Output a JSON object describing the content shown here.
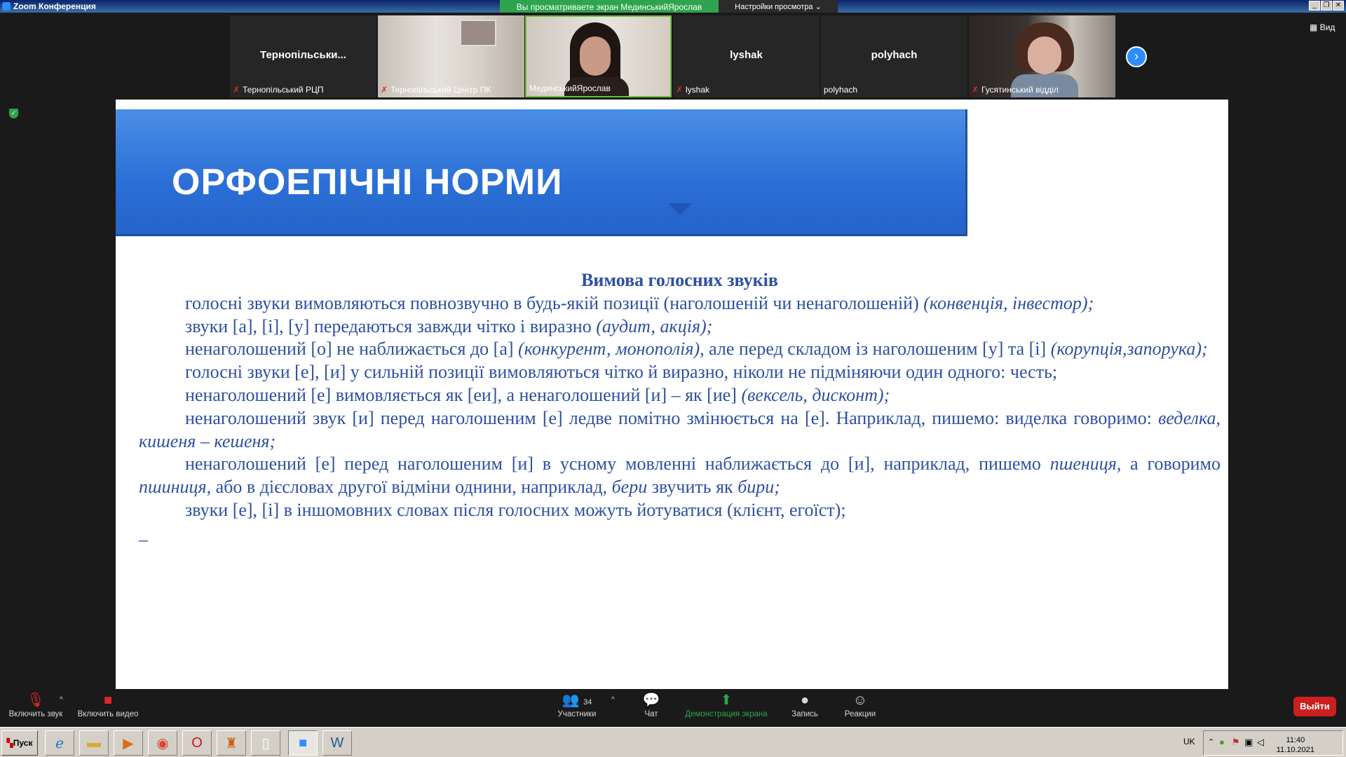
{
  "window": {
    "title": "Zoom Конференция",
    "share_banner": "Вы просматриваете экран МединськийЯрослав",
    "view_settings": "Настройки просмотра",
    "view_label": "Вид"
  },
  "participants": [
    {
      "big_name": "Тернопільськи...",
      "label": "Тернопільський РЦП",
      "muted": true,
      "video": false
    },
    {
      "big_name": "",
      "label": "Тернопільський Центр ПК",
      "muted": true,
      "video": true
    },
    {
      "big_name": "",
      "label": "МединськийЯрослав",
      "muted": false,
      "video": true,
      "active": true
    },
    {
      "big_name": "lyshak",
      "label": "lyshak",
      "muted": true,
      "video": false
    },
    {
      "big_name": "polyhach",
      "label": "polyhach",
      "muted": false,
      "video": false
    },
    {
      "big_name": "",
      "label": "Гусятинський відділ",
      "muted": true,
      "video": true
    }
  ],
  "slide": {
    "title": "ОРФОЕПІЧНІ НОРМИ",
    "subtitle": "Вимова голосних звуків",
    "p1_text": "голосні звуки вимовляються повнозвучно в будь-якій позиції (наголошеній чи ненаголошеній) ",
    "p1_ital": "(конвенція, інвестор);",
    "p2_text": "звуки [а], [і], [у] передаються завжди чітко і виразно ",
    "p2_ital": "(аудит, акція);",
    "p3_text": "ненаголошений [о] не наближається до [а] ",
    "p3_ital": "(конкурент, монополія)",
    "p3_text2": ", але перед складом із наголошеним [у] та [і] ",
    "p3_ital2": "(корупція,запорука);",
    "p4_text": " голосні звуки [е], [и] у сильній позиції вимовляються чітко й виразно, ніколи не підміняючи один одного: честь;",
    "p5_text": "ненаголошений [е] вимовляється як [еи], а ненаголошений [и] – як [ие] ",
    "p5_ital": "(вексель, дисконт);",
    "p6_text": "ненаголошений звук [и] перед наголошеним [е] ледве помітно змінюється на [е]. Наприклад, пишемо: виделка говоримо: ",
    "p6_ital": "веделка, кишеня – кешеня;",
    "p7_text": "ненаголошений [е] перед наголошеним [и] в усному мовленні наближається до [и], наприклад, пишемо ",
    "p7_ital": "пшениця",
    "p7_text2": ", а говоримо ",
    "p7_ital2": "пшиниця",
    "p7_text3": ", або в дієсловах другої відміни однини, наприклад, ",
    "p7_ital3": "бери",
    "p7_text4": " звучить як ",
    "p7_ital4": "бири;",
    "p8_text": "звуки [е], [і] в іншомовних словах після голосних можуть йотуватися (клієнт, егоїст);",
    "p9_text": "_"
  },
  "controls": {
    "audio_label": "Включить звук",
    "video_label": "Включить видео",
    "participants_label": "Участники",
    "participants_count": "34",
    "chat_label": "Чат",
    "share_label": "Демонстрация экрана",
    "record_label": "Запись",
    "reactions_label": "Реакции",
    "exit_label": "Выйти"
  },
  "taskbar": {
    "start_label": "Пуск",
    "lang": "UK",
    "time": "11:40",
    "date": "11.10.2021"
  }
}
